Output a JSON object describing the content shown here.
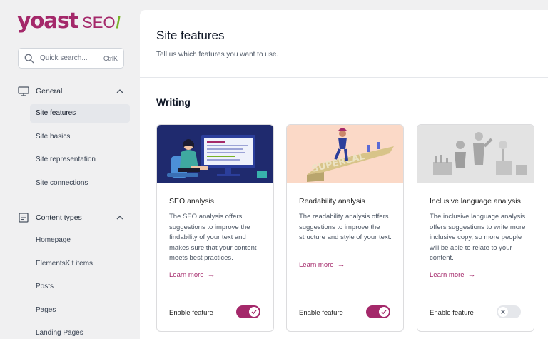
{
  "logo": {
    "main": "yoast",
    "seo": "SEO",
    "slash": "/"
  },
  "search": {
    "placeholder": "Quick search...",
    "shortcut": "CtrlK"
  },
  "sidebar": {
    "general": {
      "label": "General",
      "items": [
        {
          "label": "Site features",
          "active": true
        },
        {
          "label": "Site basics"
        },
        {
          "label": "Site representation"
        },
        {
          "label": "Site connections"
        }
      ]
    },
    "content_types": {
      "label": "Content types",
      "items": [
        {
          "label": "Homepage"
        },
        {
          "label": "ElementsKit items"
        },
        {
          "label": "Posts"
        },
        {
          "label": "Pages"
        },
        {
          "label": "Landing Pages"
        }
      ]
    }
  },
  "header": {
    "title": "Site features",
    "subtitle": "Tell us which features you want to use."
  },
  "section": {
    "title": "Writing"
  },
  "cards": [
    {
      "title": "SEO analysis",
      "desc": "The SEO analysis offers suggestions to improve the findability of your text and makes sure that your content meets best practices.",
      "link": "Learn more",
      "toggle_label": "Enable feature",
      "enabled": true
    },
    {
      "title": "Readability analysis",
      "desc": "The readability analysis offers suggestions to improve the structure and style of your text.",
      "link": "Learn more",
      "toggle_label": "Enable feature",
      "enabled": true
    },
    {
      "title": "Inclusive language analysis",
      "desc": "The inclusive language analysis offers suggestions to write more inclusive copy, so more people will be able to relate to your content.",
      "link": "Learn more",
      "toggle_label": "Enable feature",
      "enabled": false
    }
  ],
  "colors": {
    "brand": "#a4286a",
    "accent": "#77b227",
    "toggle_off": "#e5e7eb"
  },
  "icons": {
    "search": "search-icon",
    "general": "monitor-icon",
    "content_types": "document-icon",
    "chevron": "chevron-up-icon",
    "link": "arrow-right-icon",
    "toggle_on": "check-icon",
    "toggle_off": "x-icon"
  }
}
